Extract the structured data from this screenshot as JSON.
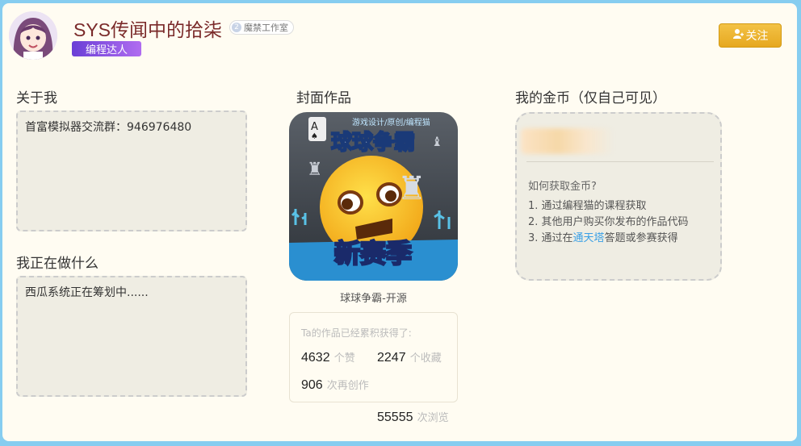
{
  "profile": {
    "username": "SYS传闻中的拾柒",
    "studio_number": "2",
    "studio": "魔禁工作室",
    "badge": "编程达人",
    "follow_label": "关注"
  },
  "about": {
    "title": "关于我",
    "text": "首富模拟器交流群：946976480"
  },
  "doing": {
    "title": "我正在做什么",
    "text": "西瓜系统正在筹划中......"
  },
  "cover": {
    "title": "封面作品",
    "tag": "游戏设计/原创/编程猫",
    "name_top": "球球争霸",
    "name_bottom": "新赛季",
    "work_name": "球球争霸-开源"
  },
  "stats": {
    "title": "Ta的作品已经累积获得了:",
    "likes": "4632",
    "likes_unit": "个赞",
    "favorites": "2247",
    "favorites_unit": "个收藏",
    "remixes": "906",
    "remixes_unit": "次再创作",
    "views": "55555",
    "views_unit": "次浏览"
  },
  "coins": {
    "title": "我的金币（仅自己可见）",
    "question": "如何获取金币?",
    "step1": "1. 通过编程猫的课程获取",
    "step2": "2. 其他用户购买你发布的作品代码",
    "step3_prefix": "3. 通过在",
    "step3_link": "通天塔",
    "step3_suffix": "答题或参赛获得"
  },
  "icons": {
    "follow": "user-icon",
    "avatar": "anime-girl-avatar"
  },
  "colors": {
    "background": "#86cdf0",
    "panel": "#fffcf2",
    "accent": "#f3c246",
    "badge": "#6a3fd6",
    "link": "#3aa0e6"
  }
}
